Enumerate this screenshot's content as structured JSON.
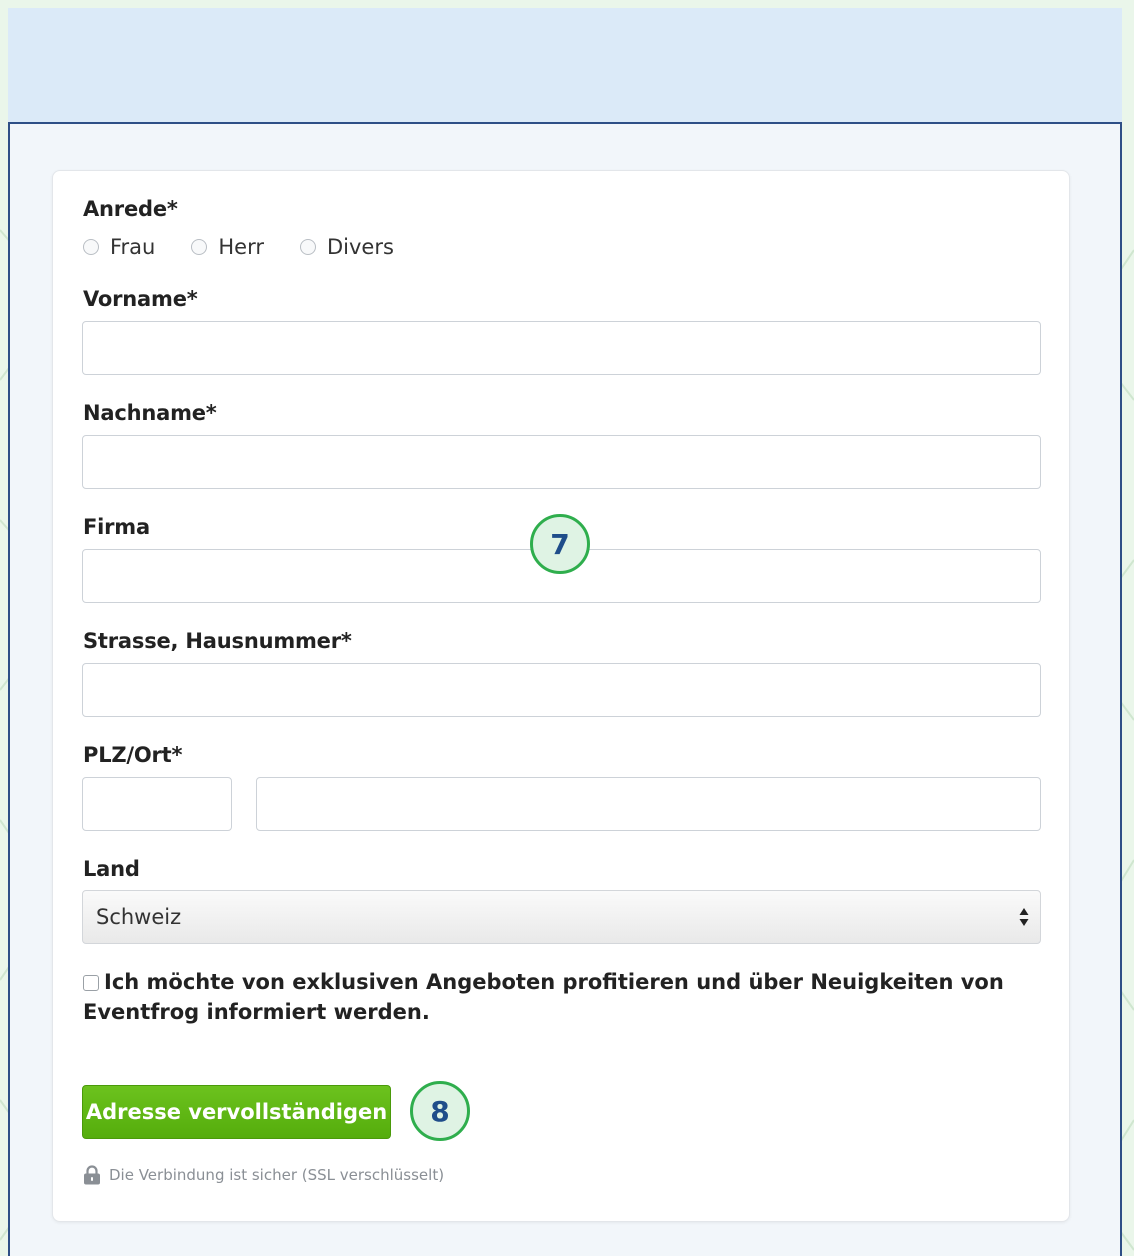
{
  "form": {
    "salutation": {
      "label": "Anrede*",
      "options": [
        "Frau",
        "Herr",
        "Divers"
      ]
    },
    "first_name": {
      "label": "Vorname*",
      "value": ""
    },
    "last_name": {
      "label": "Nachname*",
      "value": ""
    },
    "company": {
      "label": "Firma",
      "value": ""
    },
    "street": {
      "label": "Strasse, Hausnummer*",
      "value": ""
    },
    "zip_city": {
      "label": "PLZ/Ort*",
      "zip_value": "",
      "city_value": ""
    },
    "country": {
      "label": "Land",
      "value": "Schweiz"
    },
    "newsletter": {
      "label": "Ich möchte von exklusiven Angeboten profitieren und über Neuigkeiten von Eventfrog informiert werden.",
      "checked": false
    },
    "submit_label": "Adresse vervollständigen",
    "ssl_note": "Die Verbindung ist sicher (SSL verschlüsselt)"
  },
  "annotations": {
    "badge_7": "7",
    "badge_8": "8"
  },
  "colors": {
    "submit_green": "#5cb615",
    "frame_blue": "#2e4f86",
    "badge_green": "#2fae4d"
  },
  "icons": {
    "ssl": "lock-icon",
    "select": "select-arrows-icon"
  }
}
